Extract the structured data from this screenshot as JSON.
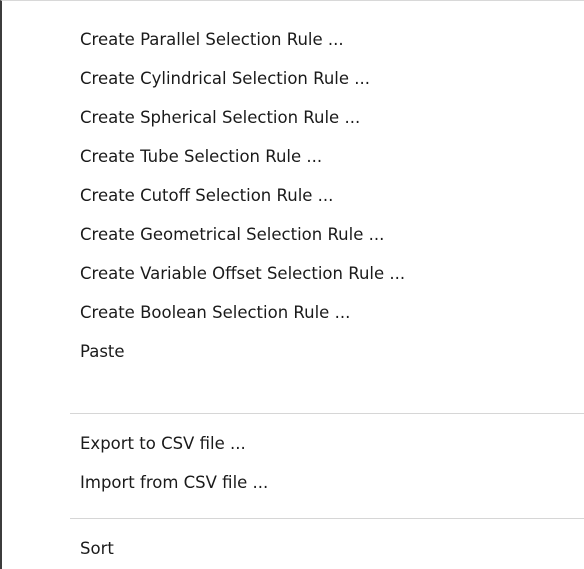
{
  "context_menu": {
    "items": [
      {
        "label": "Create Parallel Selection Rule ..."
      },
      {
        "label": "Create Cylindrical Selection Rule ..."
      },
      {
        "label": "Create Spherical Selection Rule ..."
      },
      {
        "label": "Create Tube Selection Rule ..."
      },
      {
        "label": "Create Cutoff Selection Rule ..."
      },
      {
        "label": "Create Geometrical Selection Rule ..."
      },
      {
        "label": "Create Variable Offset Selection Rule ..."
      },
      {
        "label": "Create Boolean Selection Rule ..."
      },
      {
        "label": "Paste"
      },
      {
        "label": "Export to CSV file ..."
      },
      {
        "label": "Import from CSV file ..."
      },
      {
        "label": "Sort"
      }
    ]
  }
}
